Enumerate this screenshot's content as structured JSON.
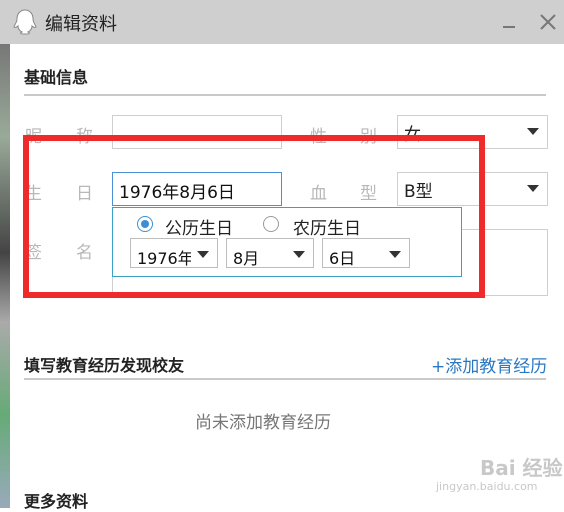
{
  "window": {
    "title": "编辑资料",
    "icons": {
      "app": "qq-penguin-icon",
      "minimize": "minimize-icon",
      "close": "close-icon"
    }
  },
  "basic_info": {
    "section_title": "基础信息",
    "nickname": {
      "label_a": "昵",
      "label_b": "称",
      "value": ""
    },
    "gender": {
      "label_a": "性",
      "label_b": "别",
      "value": "女"
    },
    "birthday": {
      "label_a": "生",
      "label_b": "日",
      "value": "1976年8月6日"
    },
    "blood_type": {
      "label_a": "血",
      "label_b": "型",
      "value": "B型"
    },
    "signature": {
      "label_a": "签",
      "label_b": "名",
      "value": ""
    }
  },
  "birthday_picker": {
    "solar_label": "公历生日",
    "lunar_label": "农历生日",
    "selected": "solar",
    "year": "1976年",
    "month": "8月",
    "day": "6日"
  },
  "education": {
    "section_title": "填写教育经历发现校友",
    "add_link": "+添加教育经历",
    "empty_text": "尚未添加教育经历"
  },
  "more": {
    "section_title": "更多资料"
  },
  "watermark": {
    "brand": "Bai 经验",
    "url": "jingyan.baidu.com"
  },
  "colors": {
    "highlight": "#ee2a2a",
    "accent": "#3b8fd6",
    "link": "#2b78c2"
  }
}
